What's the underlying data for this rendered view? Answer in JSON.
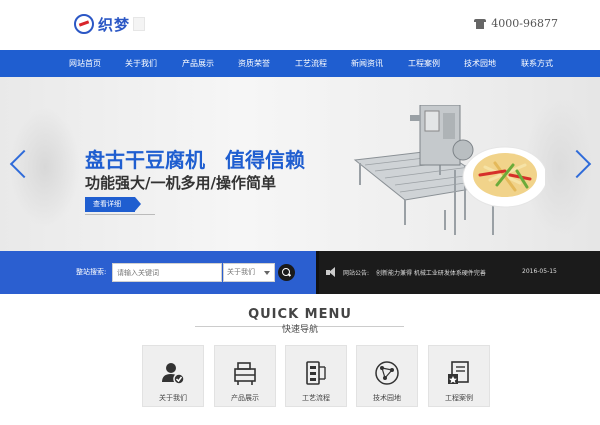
{
  "header": {
    "logo_text": "织梦",
    "phone": "4000-96877"
  },
  "nav": {
    "items": [
      "网站首页",
      "关于我们",
      "产品展示",
      "资质荣誉",
      "工艺流程",
      "新闻资讯",
      "工程案例",
      "技术园地",
      "联系方式"
    ]
  },
  "banner": {
    "headline_left": "盘古干豆腐机",
    "headline_right": "值得信赖",
    "subline": "功能强大/一机多用/操作简单",
    "button": "查看详细"
  },
  "search": {
    "label": "整站搜索:",
    "placeholder": "请输入关键词",
    "select_value": "关于我们"
  },
  "notice": {
    "label": "网站公告:",
    "text": "创新能力兼得 机械工业研发体系硬件完善",
    "date": "2016-05-15"
  },
  "quick_menu": {
    "title": "QUICK MENU",
    "subtitle": "快速导航",
    "items": [
      {
        "label": "关于我们",
        "icon": "user-check-icon"
      },
      {
        "label": "产品展示",
        "icon": "machine-icon"
      },
      {
        "label": "工艺流程",
        "icon": "flow-icon"
      },
      {
        "label": "技术园地",
        "icon": "network-icon"
      },
      {
        "label": "工程案例",
        "icon": "case-document-icon"
      }
    ]
  },
  "colors": {
    "brand_blue": "#1f5ed0",
    "notice_bg": "#1b1b1b",
    "card_bg": "#efefef"
  }
}
